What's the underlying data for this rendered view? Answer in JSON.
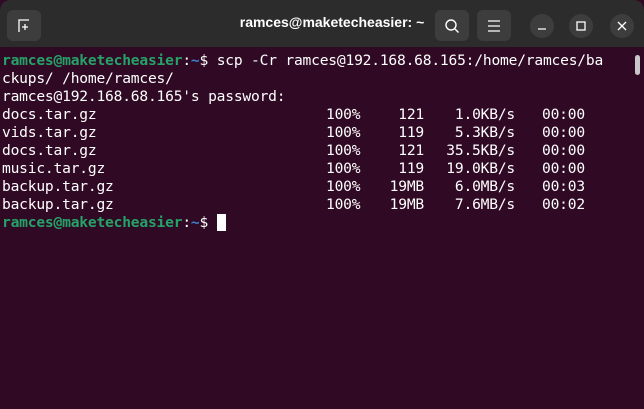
{
  "window": {
    "title": "ramces@maketecheasier: ~"
  },
  "prompt": {
    "user_host": "ramces@maketecheasier",
    "sep": ":",
    "path": "~",
    "symbol": "$ "
  },
  "command_line1": "scp -Cr ramces@192.168.68.165:/home/ramces/ba",
  "command_line2": "ckups/ /home/ramces/",
  "password_prompt": "ramces@192.168.68.165's password:",
  "transfers": [
    {
      "file": "docs.tar.gz",
      "percent": "100%",
      "size": "121",
      "rate": "1.0KB/s",
      "time": "00:00"
    },
    {
      "file": "vids.tar.gz",
      "percent": "100%",
      "size": "119",
      "rate": "5.3KB/s",
      "time": "00:00"
    },
    {
      "file": "docs.tar.gz",
      "percent": "100%",
      "size": "121",
      "rate": "35.5KB/s",
      "time": "00:00"
    },
    {
      "file": "music.tar.gz",
      "percent": "100%",
      "size": "119",
      "rate": "19.0KB/s",
      "time": "00:00"
    },
    {
      "file": "backup.tar.gz",
      "percent": "100%",
      "size": "19MB",
      "rate": "6.0MB/s",
      "time": "00:03"
    },
    {
      "file": "backup.tar.gz",
      "percent": "100%",
      "size": "19MB",
      "rate": "7.6MB/s",
      "time": "00:02"
    }
  ]
}
